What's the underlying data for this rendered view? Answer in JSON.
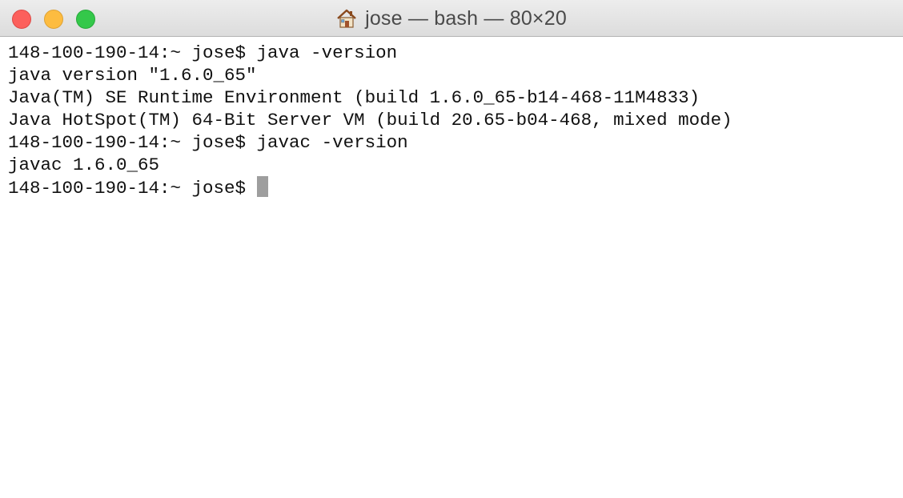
{
  "window": {
    "title": "jose — bash — 80×20",
    "title_icon": "home-icon"
  },
  "terminal": {
    "lines": [
      "148-100-190-14:~ jose$ java -version",
      "java version \"1.6.0_65\"",
      "Java(TM) SE Runtime Environment (build 1.6.0_65-b14-468-11M4833)",
      "Java HotSpot(TM) 64-Bit Server VM (build 20.65-b04-468, mixed mode)",
      "148-100-190-14:~ jose$ javac -version",
      "javac 1.6.0_65"
    ],
    "prompt": "148-100-190-14:~ jose$"
  },
  "colors": {
    "close": "#fc605c",
    "minimize": "#fdbc40",
    "zoom": "#34c84a",
    "cursor": "#9e9e9e"
  }
}
